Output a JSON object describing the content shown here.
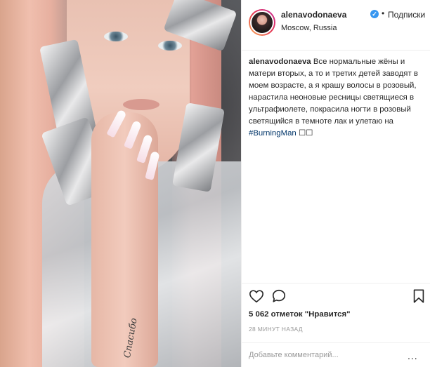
{
  "post": {
    "username": "alenavodonaeva",
    "verified_badge": "✓",
    "separator": "•",
    "follow_label": "Подписки",
    "location": "Moscow, Russia"
  },
  "caption": {
    "user": "alenavodonaeva",
    "text": "Все нормальные жёны и матери вторых, а то и третих детей заводят в моем возрасте, а я крашу волосы в розовый, нарастила неоновые ресницы светящиеся в ультрафиолете, покрасила ногти в розовый светящийся в темноте лак и улетаю на",
    "hashtag": "#BurningMan",
    "trailing_glyphs": "☐☐"
  },
  "actions": {
    "like_icon": "heart-icon",
    "comment_icon": "comment-icon",
    "save_icon": "bookmark-icon"
  },
  "likes_text": "5 062 отметок \"Нравится\"",
  "time_text": "28 МИНУТ НАЗАД",
  "comment": {
    "placeholder": "Добавьте комментарий...",
    "more": "..."
  },
  "photo": {
    "tattoo_text": "Спасибо"
  },
  "colors": {
    "accent_link": "#003569",
    "verified": "#3897f0",
    "muted": "#999999",
    "text": "#262626"
  }
}
